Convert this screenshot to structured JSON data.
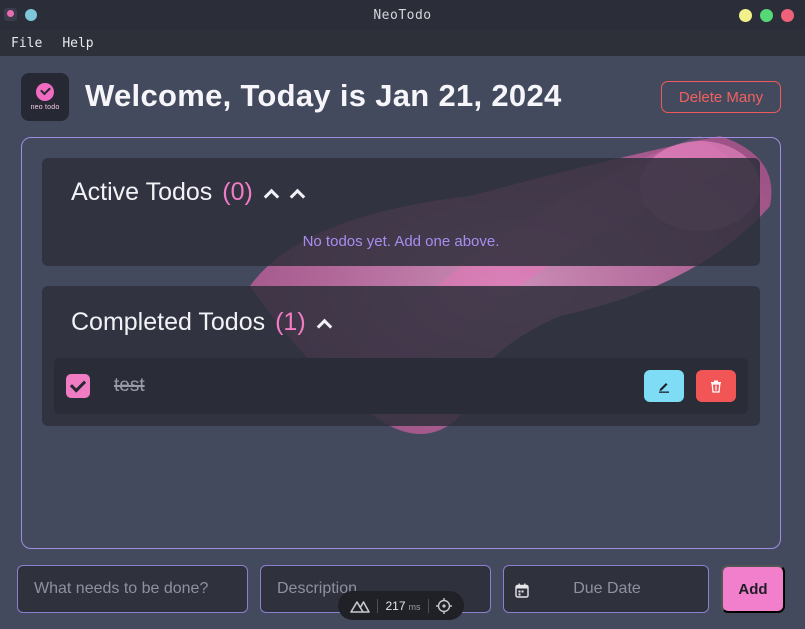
{
  "window": {
    "title": "NeoTodo"
  },
  "menu": {
    "items": [
      "File",
      "Help"
    ]
  },
  "header": {
    "logo_text": "neo todo",
    "welcome": "Welcome, Today is Jan 21, 2024",
    "delete_many_label": "Delete Many"
  },
  "active_section": {
    "title": "Active Todos",
    "count": "(0)",
    "empty_message": "No todos yet. Add one above."
  },
  "completed_section": {
    "title": "Completed Todos",
    "count": "(1)",
    "items": [
      {
        "title": "test",
        "completed": true
      }
    ]
  },
  "form": {
    "todo_placeholder": "What needs to be done?",
    "description_placeholder": "Description",
    "due_date_label": "Due Date",
    "add_label": "Add"
  },
  "devtools": {
    "render_time": "217",
    "unit": "ms"
  },
  "colors": {
    "accent_pink": "#f07cc3",
    "panel_border": "#a08de0",
    "danger": "#f25555",
    "edit": "#7fdcf5"
  },
  "icons": [
    "app-icon",
    "logo-icon",
    "chevron-up-icon",
    "check-icon",
    "pencil-icon",
    "trash-icon",
    "calendar-icon",
    "nuxt-icon",
    "crosshair-icon"
  ]
}
